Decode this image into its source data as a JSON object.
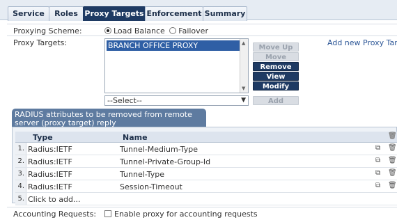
{
  "tabs": [
    {
      "label": "Service"
    },
    {
      "label": "Roles"
    },
    {
      "label": "Proxy Targets",
      "active": true
    },
    {
      "label": "Enforcement"
    },
    {
      "label": "Summary"
    }
  ],
  "proxying_scheme": {
    "label": "Proxying Scheme:",
    "options": [
      {
        "label": "Load Balance",
        "selected": true
      },
      {
        "label": "Failover",
        "selected": false
      }
    ]
  },
  "proxy_targets": {
    "label": "Proxy Targets:",
    "list_items": [
      "BRANCH OFFICE PROXY"
    ],
    "select_value": "--Select--",
    "buttons": {
      "move_up": "Move Up",
      "move_down": "Move Down",
      "remove": "Remove",
      "view_details": "View Details",
      "modify": "Modify",
      "add": "Add"
    },
    "add_new_link": "Add new Proxy Target"
  },
  "radius_attrs": {
    "title": "RADIUS attributes to be removed from remote server (proxy target) reply",
    "columns": {
      "type": "Type",
      "name": "Name"
    },
    "rows": [
      {
        "num": "1.",
        "type": "Radius:IETF",
        "name": "Tunnel-Medium-Type"
      },
      {
        "num": "2.",
        "type": "Radius:IETF",
        "name": "Tunnel-Private-Group-Id"
      },
      {
        "num": "3.",
        "type": "Radius:IETF",
        "name": "Tunnel-Type"
      },
      {
        "num": "4.",
        "type": "Radius:IETF",
        "name": "Session-Timeout"
      }
    ],
    "add_row": {
      "num": "5.",
      "label": "Click to add..."
    }
  },
  "accounting": {
    "label": "Accounting Requests:",
    "checkbox_label": "Enable proxy for accounting requests",
    "checked": false
  }
}
